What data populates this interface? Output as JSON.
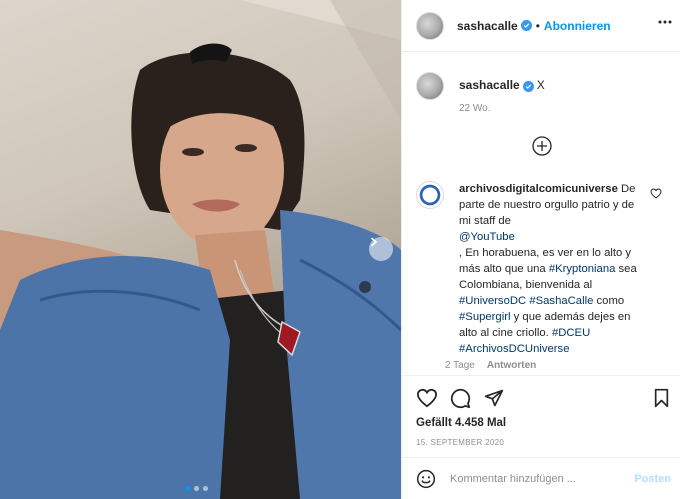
{
  "post": {
    "username": "sashacalle",
    "follow_label": "Abonnieren",
    "separator": "•",
    "caption_text": "X",
    "caption_time": "22 Wo."
  },
  "photo": {
    "carousel_dots": 3,
    "active_dot": 1
  },
  "comment": {
    "username": "archivosdigitalcomicuniverse",
    "text_1": "De parte de nuestro orgullo patrio y de mi staff de",
    "mention": "@YouTube",
    "text_2": ", En horabuena, es ver en lo alto y más alto que una",
    "tag_1": "#Kryptoniana",
    "text_3": "sea Colombiana, bienvenida al",
    "tag_2": "#UniversoDC",
    "tag_3": "#SashaCalle",
    "text_4": "como",
    "tag_4": "#Supergirl",
    "text_5": "y que además dejes en alto al cine criollo.",
    "tag_5": "#DCEU",
    "tag_6": "#ArchivosDCUniverse",
    "time": "2 Tage",
    "reply_label": "Antworten"
  },
  "stats": {
    "likes": "Gefällt 4.458 Mal",
    "date": "15. SEPTEMBER 2020"
  },
  "composer": {
    "placeholder": "Kommentar hinzufügen ...",
    "post_label": "Posten"
  },
  "icons": {
    "verified": "verified-badge-icon",
    "more": "more-options-icon",
    "load_more": "plus-circle-icon",
    "like": "heart-icon",
    "comment": "comment-bubble-icon",
    "share": "paper-plane-icon",
    "save": "bookmark-icon",
    "emoji": "smiley-icon",
    "next": "chevron-right-icon"
  },
  "colors": {
    "accent": "#0095f6",
    "verified": "#3897f0",
    "link": "#00376b",
    "muted": "#8e8e8e"
  }
}
